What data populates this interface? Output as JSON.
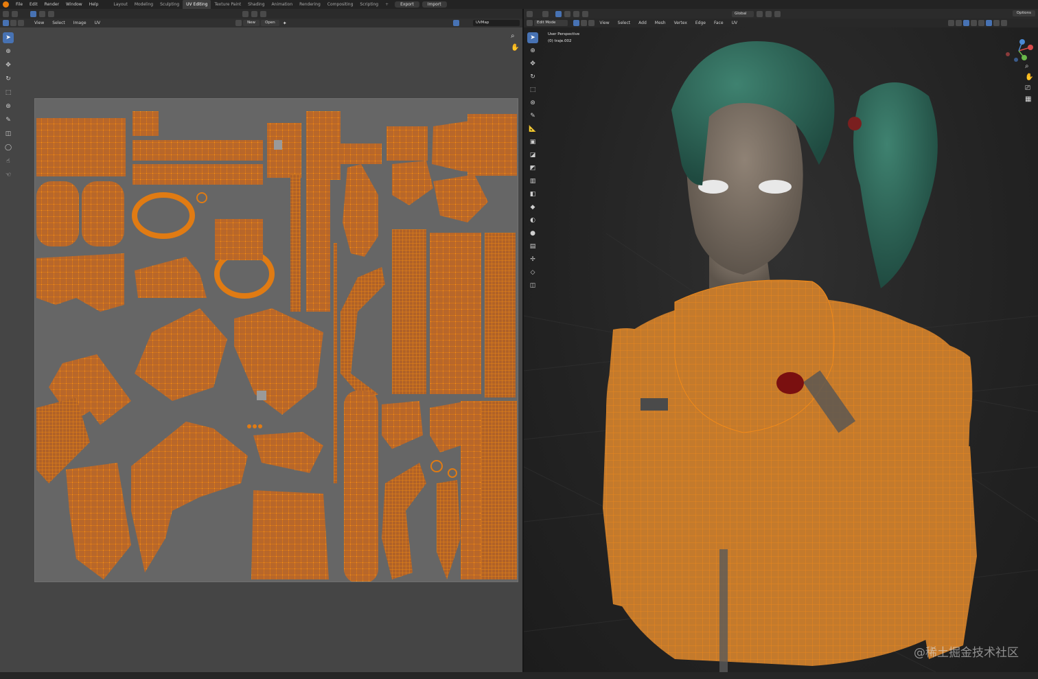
{
  "topbar": {
    "menus": [
      "File",
      "Edit",
      "Render",
      "Window",
      "Help"
    ],
    "workspaces": [
      "Layout",
      "Modeling",
      "Sculpting",
      "UV Editing",
      "Texture Paint",
      "Shading",
      "Animation",
      "Rendering",
      "Compositing",
      "Scripting"
    ],
    "active_workspace": "UV Editing",
    "export_label": "Export",
    "import_label": "Import"
  },
  "uv_editor": {
    "menus": [
      "View",
      "Select",
      "Image",
      "UV"
    ],
    "new_label": "New",
    "open_label": "Open",
    "uvmap_label": "UVMap"
  },
  "viewport": {
    "mode_label": "Edit Mode",
    "menus": [
      "View",
      "Select",
      "Add",
      "Mesh",
      "Vertex",
      "Edge",
      "Face",
      "UV"
    ],
    "orientation_label": "Global",
    "options_label": "Options",
    "perspective_label": "User Perspective",
    "object_label": "(0) traje.002"
  },
  "watermark": "@稀土掘金技术社区",
  "colors": {
    "uv_orange": "#e07b13",
    "island_fill": "#b8672a",
    "accent": "#4772b3"
  }
}
